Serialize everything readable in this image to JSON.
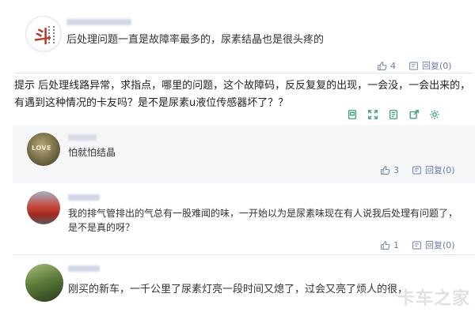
{
  "comments": [
    {
      "avatar_text": "斗",
      "text": "后处理问题一直是故障率最多的，尿素结晶也是很头疼的",
      "likes": "4",
      "reply": "回复(0)"
    },
    {
      "text": "怕就怕结晶",
      "avatar_text": "LOVE",
      "likes": "3",
      "reply": "回复(0)"
    },
    {
      "text": "我的排气管排出的气总有一股难闻的味，一开始以为是尿素味现在有人说我后处理有问题了，是不是真的呀？",
      "likes": "1",
      "reply": "回复(0)"
    },
    {
      "text": "刚买的新车，一千公里了尿素灯亮一段时间又熄了，过会又亮了烦人的很，"
    }
  ],
  "tip": {
    "text": "提示   后处理线路异常，求指点，哪里的问题，这个故障码，反反复复的出现，一会没，一会出来的，有遇到这种情况的卡友吗？是不是尿素u液位传感器坏了？？"
  },
  "toolbar_icons": [
    "image-icon",
    "expand-icon",
    "copy-icon",
    "share-icon",
    "settings-icon"
  ],
  "watermark": "卡车之家",
  "colors": {
    "accent": "#6b7fa6",
    "toolbar_green": "#3aa17a"
  }
}
